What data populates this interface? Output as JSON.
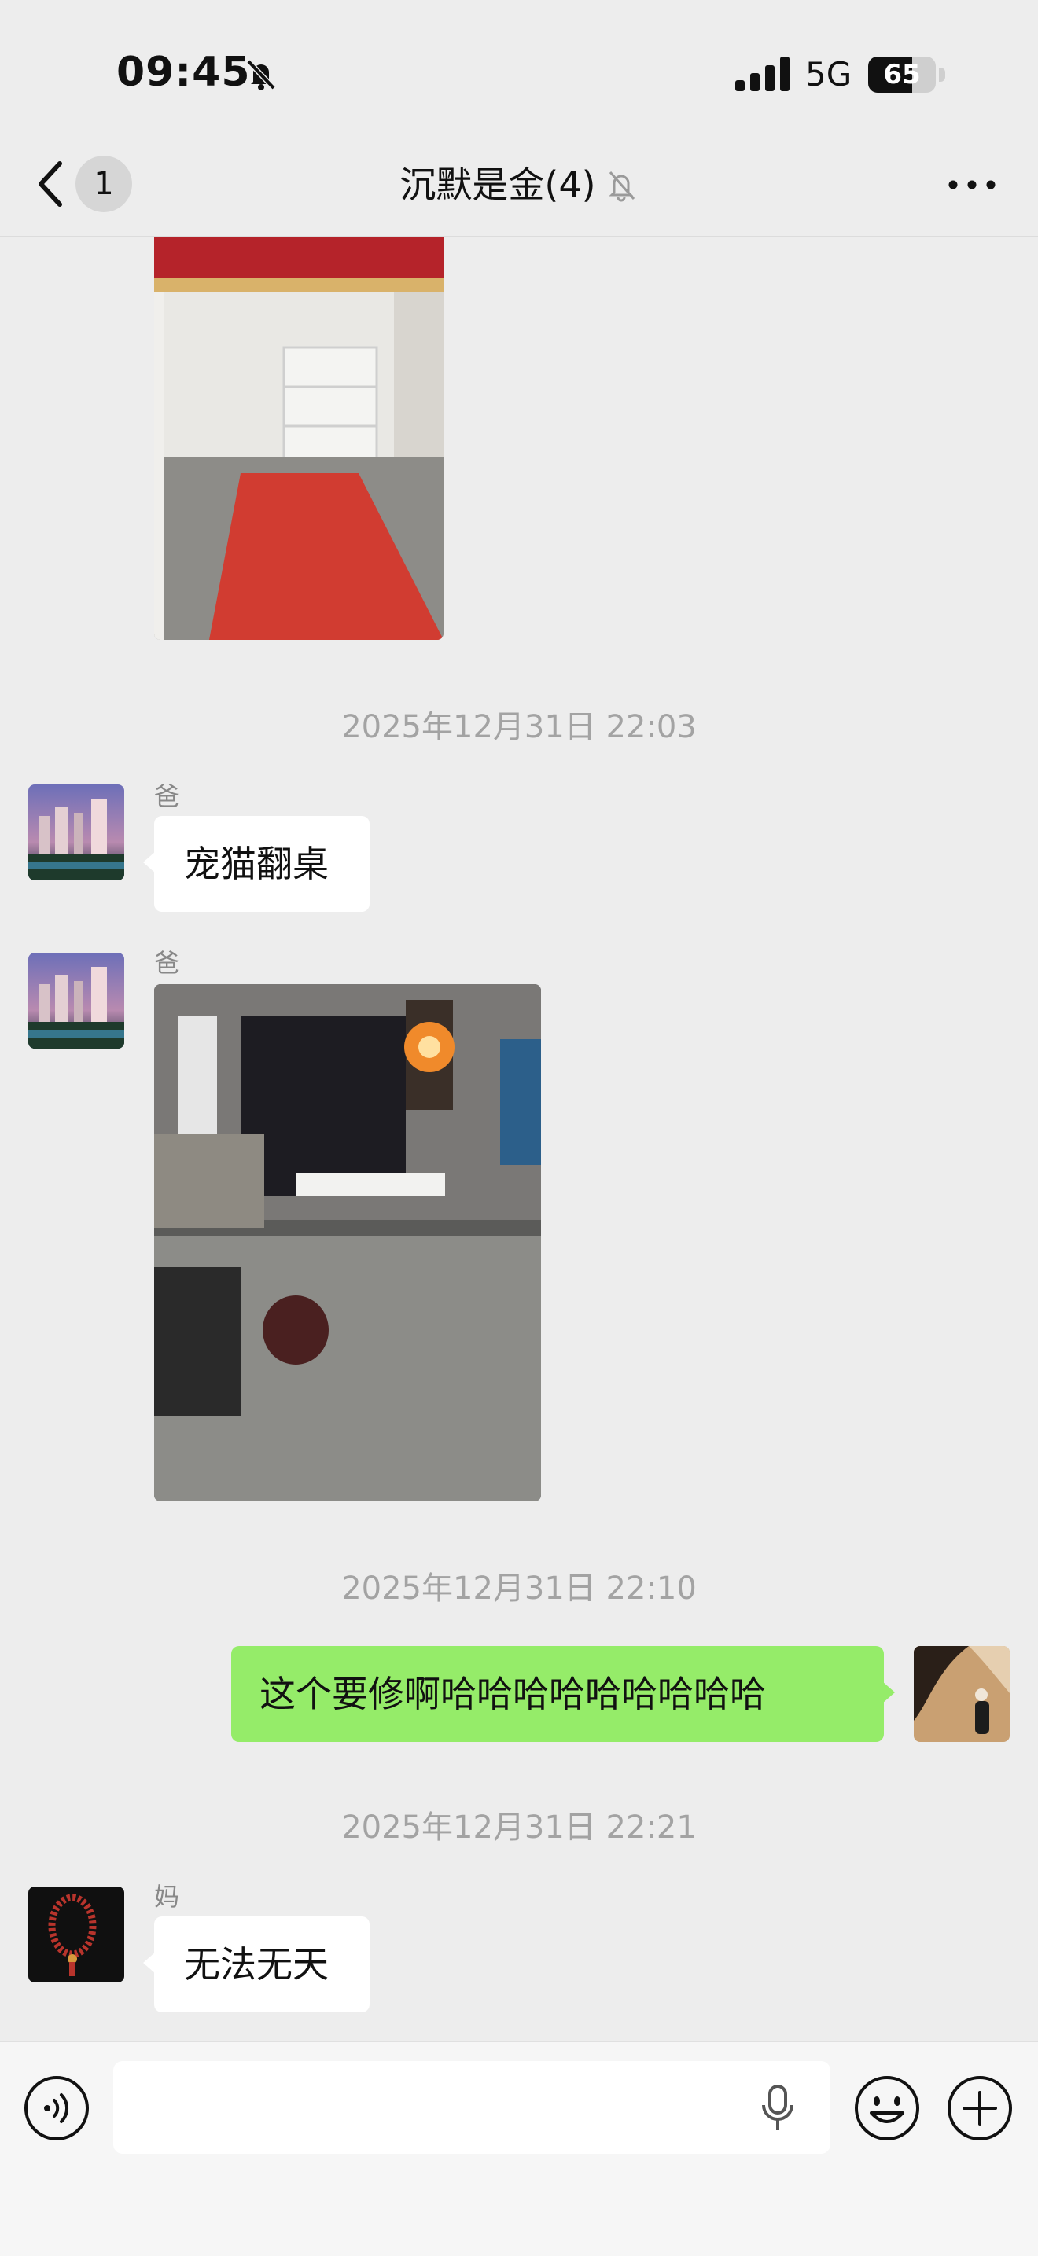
{
  "status_bar": {
    "time": "09:45",
    "network": "5G",
    "battery": "65",
    "battery_level": 0.65,
    "icons": [
      "bell-slash-icon",
      "signal-icon",
      "battery-icon"
    ]
  },
  "nav": {
    "back_count": "1",
    "title": "沉默是金(4)",
    "icons": [
      "back-chevron-icon",
      "bell-slash-icon",
      "more-dots-icon"
    ]
  },
  "messages": {
    "ts1": "2025年12月31日 22:03",
    "msg1": {
      "sender": "爸",
      "text": "宠猫翻桌"
    },
    "msg2": {
      "sender": "爸"
    },
    "ts2": "2025年12月31日 22:10",
    "msg3": {
      "text": "这个要修啊哈哈哈哈哈哈哈哈哈"
    },
    "ts3": "2025年12月31日 22:21",
    "msg4": {
      "sender": "妈",
      "text": "无法无天"
    }
  },
  "input_bar": {
    "text": "",
    "icons": [
      "voice-icon",
      "mic-icon",
      "emoji-icon",
      "plus-icon"
    ]
  },
  "colors": {
    "background": "#ededed",
    "outgoing_bubble": "#95ec69",
    "incoming_bubble": "#ffffff",
    "timestamp": "#a3a3a3"
  }
}
